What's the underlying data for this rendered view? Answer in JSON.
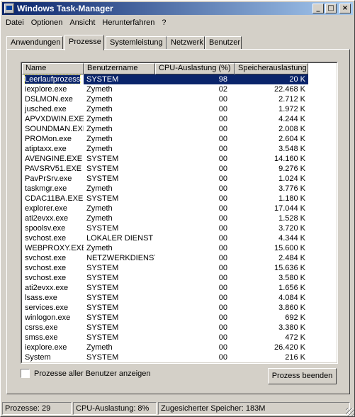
{
  "window": {
    "title": "Windows Task-Manager"
  },
  "titlebar_buttons": {
    "minimize": "_",
    "maximize": "□",
    "close": "×"
  },
  "menu": [
    "Datei",
    "Optionen",
    "Ansicht",
    "Herunterfahren",
    "?"
  ],
  "tabs": [
    "Anwendungen",
    "Prozesse",
    "Systemleistung",
    "Netzwerk",
    "Benutzer"
  ],
  "active_tab": "Prozesse",
  "columns": [
    "Name",
    "Benutzername",
    "CPU-Auslastung (%)",
    "Speicherauslastung"
  ],
  "processes": [
    {
      "name": "Leerlaufprozess",
      "user": "SYSTEM",
      "cpu": "98",
      "mem": "20 K",
      "selected": true
    },
    {
      "name": "iexplore.exe",
      "user": "Zymeth",
      "cpu": "02",
      "mem": "22.468 K"
    },
    {
      "name": "DSLMON.exe",
      "user": "Zymeth",
      "cpu": "00",
      "mem": "2.712 K"
    },
    {
      "name": "jusched.exe",
      "user": "Zymeth",
      "cpu": "00",
      "mem": "1.972 K"
    },
    {
      "name": "APVXDWIN.EXE",
      "user": "Zymeth",
      "cpu": "00",
      "mem": "4.244 K"
    },
    {
      "name": "SOUNDMAN.EXE",
      "user": "Zymeth",
      "cpu": "00",
      "mem": "2.008 K"
    },
    {
      "name": "PROMon.exe",
      "user": "Zymeth",
      "cpu": "00",
      "mem": "2.604 K"
    },
    {
      "name": "atiptaxx.exe",
      "user": "Zymeth",
      "cpu": "00",
      "mem": "3.548 K"
    },
    {
      "name": "AVENGINE.EXE",
      "user": "SYSTEM",
      "cpu": "00",
      "mem": "14.160 K"
    },
    {
      "name": "PAVSRV51.EXE",
      "user": "SYSTEM",
      "cpu": "00",
      "mem": "9.276 K"
    },
    {
      "name": "PavPrSrv.exe",
      "user": "SYSTEM",
      "cpu": "00",
      "mem": "1.024 K"
    },
    {
      "name": "taskmgr.exe",
      "user": "Zymeth",
      "cpu": "00",
      "mem": "3.776 K"
    },
    {
      "name": "CDAC11BA.EXE",
      "user": "SYSTEM",
      "cpu": "00",
      "mem": "1.180 K"
    },
    {
      "name": "explorer.exe",
      "user": "Zymeth",
      "cpu": "00",
      "mem": "17.044 K"
    },
    {
      "name": "ati2evxx.exe",
      "user": "Zymeth",
      "cpu": "00",
      "mem": "1.528 K"
    },
    {
      "name": "spoolsv.exe",
      "user": "SYSTEM",
      "cpu": "00",
      "mem": "3.720 K"
    },
    {
      "name": "svchost.exe",
      "user": "LOKALER DIENST",
      "cpu": "00",
      "mem": "4.344 K"
    },
    {
      "name": "WEBPROXY.EXE",
      "user": "Zymeth",
      "cpu": "00",
      "mem": "15.600 K"
    },
    {
      "name": "svchost.exe",
      "user": "NETZWERKDIENST",
      "cpu": "00",
      "mem": "2.484 K"
    },
    {
      "name": "svchost.exe",
      "user": "SYSTEM",
      "cpu": "00",
      "mem": "15.636 K"
    },
    {
      "name": "svchost.exe",
      "user": "SYSTEM",
      "cpu": "00",
      "mem": "3.580 K"
    },
    {
      "name": "ati2evxx.exe",
      "user": "SYSTEM",
      "cpu": "00",
      "mem": "1.656 K"
    },
    {
      "name": "lsass.exe",
      "user": "SYSTEM",
      "cpu": "00",
      "mem": "4.084 K"
    },
    {
      "name": "services.exe",
      "user": "SYSTEM",
      "cpu": "00",
      "mem": "3.860 K"
    },
    {
      "name": "winlogon.exe",
      "user": "SYSTEM",
      "cpu": "00",
      "mem": "692 K"
    },
    {
      "name": "csrss.exe",
      "user": "SYSTEM",
      "cpu": "00",
      "mem": "3.380 K"
    },
    {
      "name": "smss.exe",
      "user": "SYSTEM",
      "cpu": "00",
      "mem": "472 K"
    },
    {
      "name": "iexplore.exe",
      "user": "Zymeth",
      "cpu": "00",
      "mem": "26.420 K"
    },
    {
      "name": "System",
      "user": "SYSTEM",
      "cpu": "00",
      "mem": "216 K"
    }
  ],
  "show_all_users_label": "Prozesse aller Benutzer anzeigen",
  "show_all_users_checked": false,
  "end_process_label": "Prozess beenden",
  "status": {
    "processes": "Prozesse: 29",
    "cpu": "CPU-Auslastung: 8%",
    "commit": "Zugesicherter Speicher: 183M"
  },
  "colors": {
    "title_start": "#0a246a",
    "title_end": "#a6caf0",
    "selection": "#0a246a",
    "face": "#d4d0c8"
  }
}
